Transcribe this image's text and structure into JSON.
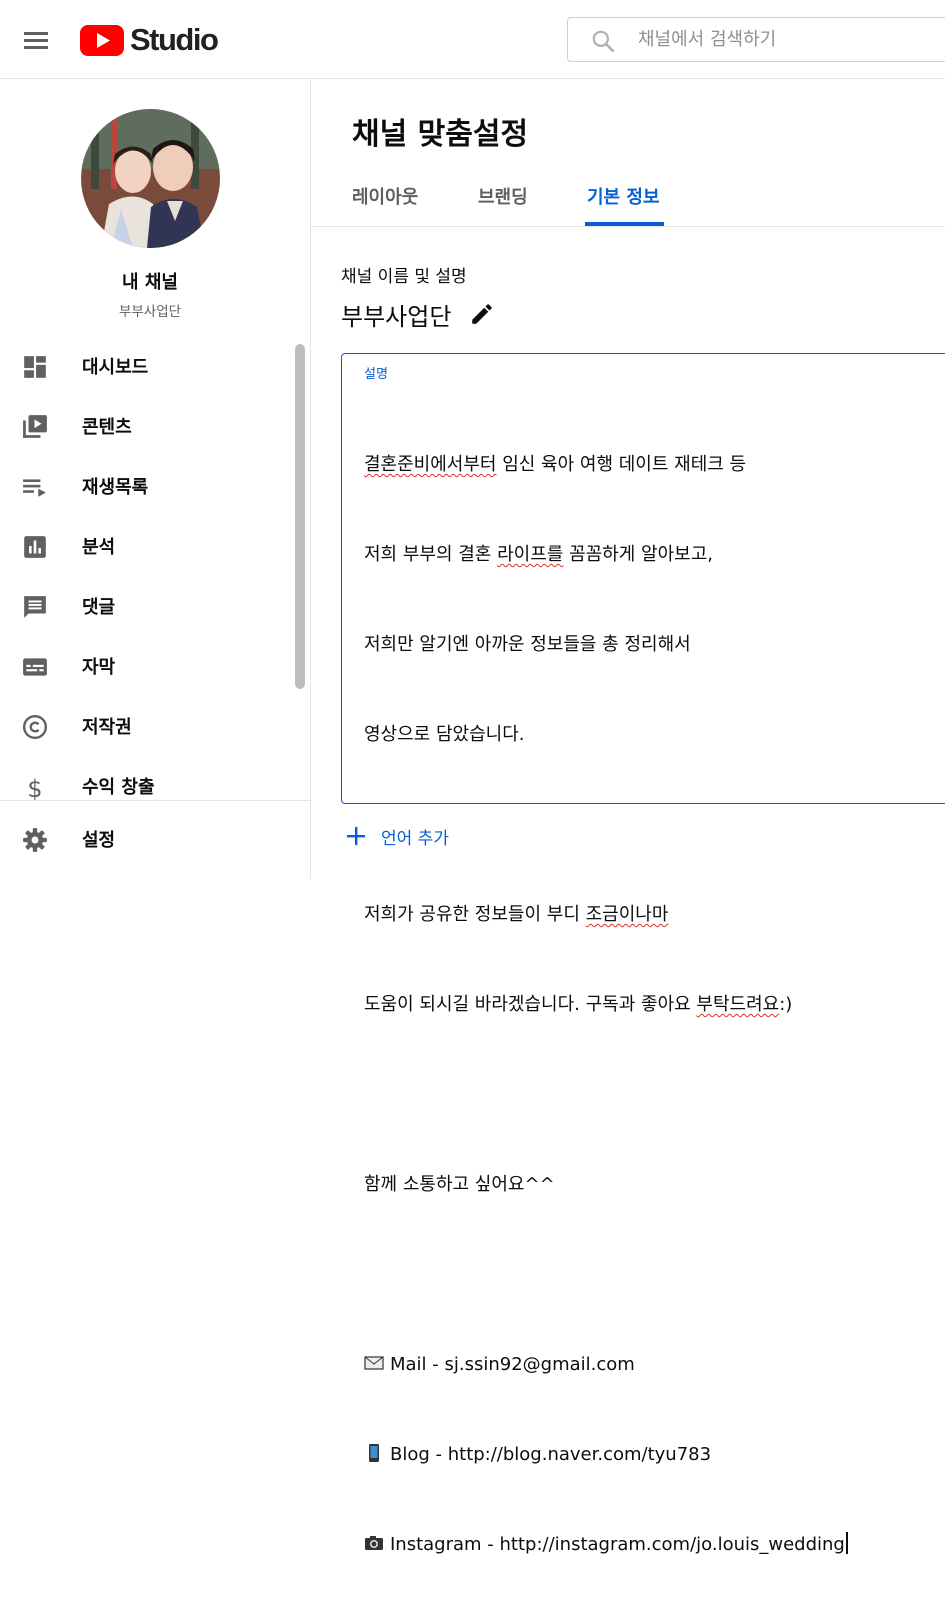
{
  "header": {
    "logo_text": "Studio",
    "search_placeholder": "채널에서 검색하기"
  },
  "sidebar": {
    "channel_title": "내 채널",
    "channel_subtitle": "부부사업단",
    "items": [
      {
        "label": "대시보드",
        "icon": "dashboard-icon"
      },
      {
        "label": "콘텐츠",
        "icon": "content-icon"
      },
      {
        "label": "재생목록",
        "icon": "playlist-icon"
      },
      {
        "label": "분석",
        "icon": "analytics-icon"
      },
      {
        "label": "댓글",
        "icon": "comments-icon"
      },
      {
        "label": "자막",
        "icon": "subtitles-icon"
      },
      {
        "label": "저작권",
        "icon": "copyright-icon"
      },
      {
        "label": "수익 창출",
        "icon": "dollar-icon"
      }
    ],
    "settings_label": "설정"
  },
  "main": {
    "page_title": "채널 맞춤설정",
    "tabs": [
      {
        "label": "레이아웃",
        "active": false
      },
      {
        "label": "브랜딩",
        "active": false
      },
      {
        "label": "기본 정보",
        "active": true
      }
    ],
    "section_label": "채널 이름 및 설명",
    "channel_name": "부부사업단",
    "description_label": "설명",
    "description_lines": {
      "l1a": "결혼준비에서부터",
      "l1b": " 임신 육아 여행 데이트 재테크 등",
      "l2a": "저희 부부의 결혼 ",
      "l2b": "라이프를",
      "l2c": " 꼼꼼하게 알아보고,",
      "l3": "저희만 알기엔 아까운 정보들을 총 정리해서",
      "l4": "영상으로 담았습니다.",
      "l5": "",
      "l6a": "저희가 공유한 정보들이 부디 ",
      "l6b": "조금이나마",
      "l7a": "도움이 되시길 바라겠습니다. 구독과 좋아요 ",
      "l7b": "부탁드려요",
      "l7c": ":)",
      "l8": "",
      "l9": "함께 소통하고 싶어요^^",
      "l10": "",
      "l11": "Mail - sj.ssin92@gmail.com",
      "l12": "Blog - http://blog.naver.com/tyu783",
      "l13": "Instagram - http://instagram.com/jo.louis_wedding"
    },
    "add_language_label": "언어 추가"
  },
  "colors": {
    "accent": "#065fd4",
    "youtube_red": "#ff0000",
    "icon_gray": "#606060",
    "spell_underline": "#d93025"
  }
}
